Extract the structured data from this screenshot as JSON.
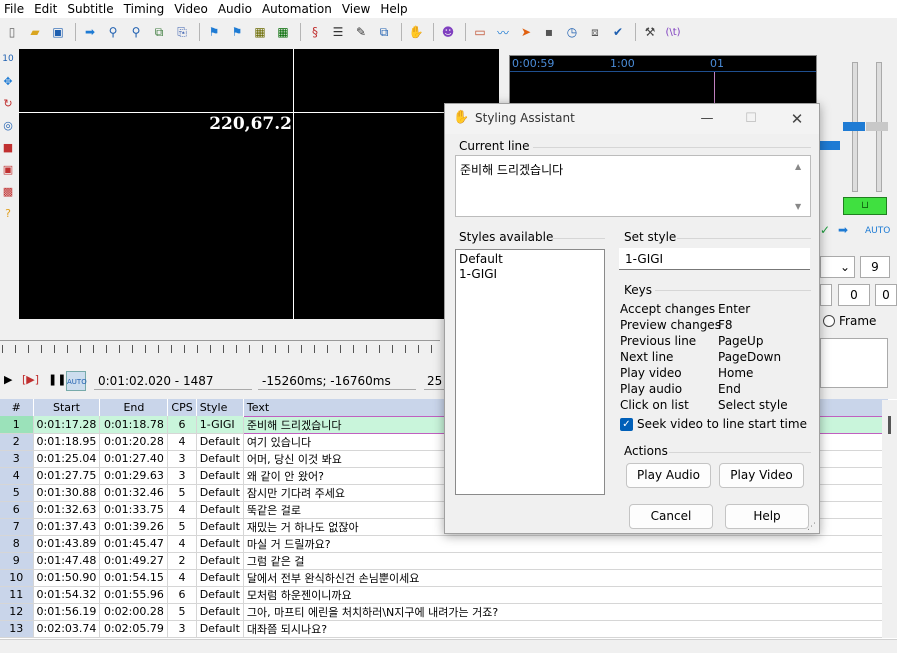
{
  "menu": [
    "File",
    "Edit",
    "Subtitle",
    "Timing",
    "Video",
    "Audio",
    "Automation",
    "View",
    "Help"
  ],
  "toolbar_icons": [
    "new-file-icon",
    "open-folder-icon",
    "save-icon",
    "jump-arrow-icon",
    "find-icon",
    "find-replace-icon",
    "copy-icon",
    "paste-icon",
    "video-start-icon",
    "video-end-icon",
    "film-icon",
    "film-icon-2",
    "styles-icon",
    "properties-icon",
    "attachments-icon",
    "fonts-icon",
    "style-assistant-icon",
    "translation-icon",
    "resample-icon",
    "timing-post-icon",
    "kanji-timer-icon",
    "stop-icon",
    "clock-icon",
    "scale-icon",
    "spellcheck-icon",
    "options-icon",
    "automation-icon"
  ],
  "video": {
    "coord_readout": "220,67.2"
  },
  "playback": {
    "time": "0:01:02.020 - 1487",
    "offset": "-15260ms; -16760ms",
    "zoom": "25"
  },
  "audio": {
    "ruler": [
      "0:00:59",
      "1:00",
      "01"
    ],
    "auto_label": "AUTO"
  },
  "edit_panel": {
    "layer": "9",
    "margin_mid": "0",
    "margin_right": "0",
    "frame_label": "Frame"
  },
  "grid": {
    "headers": [
      "#",
      "Start",
      "End",
      "CPS",
      "Style",
      "Text"
    ],
    "rows": [
      {
        "n": "1",
        "start": "0:01:17.28",
        "end": "0:01:18.78",
        "cps": "6",
        "style": "1-GIGI",
        "text": "준비해 드리겠습니다"
      },
      {
        "n": "2",
        "start": "0:01:18.95",
        "end": "0:01:20.28",
        "cps": "4",
        "style": "Default",
        "text": "여기 있습니다"
      },
      {
        "n": "3",
        "start": "0:01:25.04",
        "end": "0:01:27.40",
        "cps": "3",
        "style": "Default",
        "text": "어머, 당신 이것 봐요"
      },
      {
        "n": "4",
        "start": "0:01:27.75",
        "end": "0:01:29.63",
        "cps": "3",
        "style": "Default",
        "text": "왜 같이 안 왔어?"
      },
      {
        "n": "5",
        "start": "0:01:30.88",
        "end": "0:01:32.46",
        "cps": "5",
        "style": "Default",
        "text": "잠시만 기다려 주세요"
      },
      {
        "n": "6",
        "start": "0:01:32.63",
        "end": "0:01:33.75",
        "cps": "4",
        "style": "Default",
        "text": "뚝같은 걸로"
      },
      {
        "n": "7",
        "start": "0:01:37.43",
        "end": "0:01:39.26",
        "cps": "5",
        "style": "Default",
        "text": "재밌는 거 하나도 없잖아"
      },
      {
        "n": "8",
        "start": "0:01:43.89",
        "end": "0:01:45.47",
        "cps": "4",
        "style": "Default",
        "text": "마실 거 드릴까요?"
      },
      {
        "n": "9",
        "start": "0:01:47.48",
        "end": "0:01:49.27",
        "cps": "2",
        "style": "Default",
        "text": "그럼 같은 걸"
      },
      {
        "n": "10",
        "start": "0:01:50.90",
        "end": "0:01:54.15",
        "cps": "4",
        "style": "Default",
        "text": "달에서 전부 완식하신건 손님뿐이세요"
      },
      {
        "n": "11",
        "start": "0:01:54.32",
        "end": "0:01:55.96",
        "cps": "6",
        "style": "Default",
        "text": "모처럼 하운젠이니까요"
      },
      {
        "n": "12",
        "start": "0:01:56.19",
        "end": "0:02:00.28",
        "cps": "5",
        "style": "Default",
        "text": "그아, 마프티 에린을 처치하러\\N지구에 내려가는 거죠?"
      },
      {
        "n": "13",
        "start": "0:02:03.74",
        "end": "0:02:05.79",
        "cps": "3",
        "style": "Default",
        "text": "대좌쯤 되시나요?"
      }
    ]
  },
  "dialog": {
    "title": "Styling Assistant",
    "current_line_label": "Current line",
    "current_line_text": "준비해 드리겠습니다",
    "styles_available_label": "Styles available",
    "styles": [
      "Default",
      "1-GIGI"
    ],
    "set_style_label": "Set style",
    "set_style_value": "1-GIGI",
    "keys_label": "Keys",
    "keys": [
      {
        "action": "Accept changes",
        "key": "Enter"
      },
      {
        "action": "Preview changes",
        "key": "F8"
      },
      {
        "action": "Previous line",
        "key": "PageUp"
      },
      {
        "action": "Next line",
        "key": "PageDown"
      },
      {
        "action": "Play video",
        "key": "Home"
      },
      {
        "action": "Play audio",
        "key": "End"
      },
      {
        "action": "Click on list",
        "key": "Select style"
      }
    ],
    "seek_checkbox_label": "Seek video to line start time",
    "seek_checked": true,
    "actions_label": "Actions",
    "play_audio": "Play Audio",
    "play_video": "Play Video",
    "cancel": "Cancel",
    "help": "Help"
  }
}
